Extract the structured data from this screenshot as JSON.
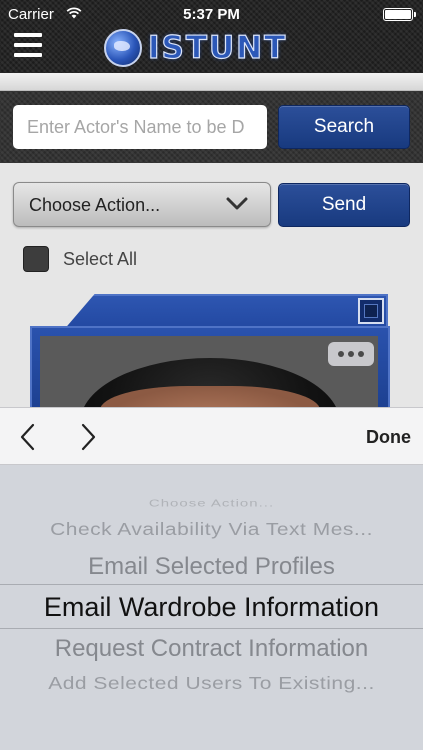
{
  "status_bar": {
    "carrier": "Carrier",
    "time": "5:37 PM",
    "icons": [
      "wifi-icon",
      "battery-icon"
    ]
  },
  "header": {
    "menu_icon": "hamburger-menu-icon",
    "logo_text": "ISTUNT",
    "logo_icon": "globe-icon"
  },
  "search": {
    "placeholder": "Enter Actor's Name to be D",
    "value": "",
    "button_label": "Search"
  },
  "actions": {
    "selected": "Choose Action...",
    "send_label": "Send",
    "select_all_label": "Select All",
    "select_all_checked": false
  },
  "profile_card": {
    "more_icon": "more-dots-icon",
    "checkbox_checked": false
  },
  "picker_toolbar": {
    "prev_icon": "chevron-left-icon",
    "next_icon": "chevron-right-icon",
    "done_label": "Done"
  },
  "picker": {
    "options": [
      "Choose Action...",
      "Check Availability Via Text Mes...",
      "Email Selected Profiles",
      "Email Wardrobe Information",
      "Request Contract Information",
      "Add Selected Users To Existing..."
    ],
    "selected": "Email Wardrobe Information"
  },
  "colors": {
    "accent_blue": "#1f4189",
    "header_dark": "#1c1c1c",
    "picker_bg": "#d2d5db"
  }
}
